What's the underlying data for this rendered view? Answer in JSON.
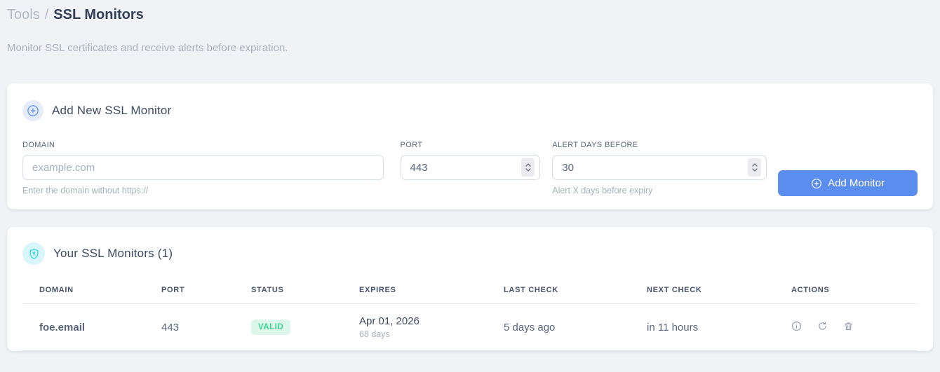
{
  "breadcrumb": {
    "section": "Tools",
    "separator": "/",
    "current": "SSL Monitors"
  },
  "subtitle": "Monitor SSL certificates and receive alerts before expiration.",
  "add_monitor_card": {
    "title": "Add New SSL Monitor",
    "icon": "circle-plus-icon",
    "fields": {
      "domain": {
        "label": "DOMAIN",
        "placeholder": "example.com",
        "value": "",
        "helper": "Enter the domain without https://"
      },
      "port": {
        "label": "PORT",
        "value": "443"
      },
      "alert_days": {
        "label": "ALERT DAYS BEFORE",
        "value": "30",
        "helper": "Alert X days before expiry"
      }
    },
    "submit_label": "Add Monitor"
  },
  "monitors_card": {
    "title": "Your SSL Monitors (1)",
    "count": 1,
    "icon": "shield-icon",
    "table": {
      "headers": [
        "DOMAIN",
        "PORT",
        "STATUS",
        "EXPIRES",
        "LAST CHECK",
        "NEXT CHECK",
        "ACTIONS"
      ],
      "rows": [
        {
          "domain": "foe.email",
          "port": "443",
          "status": "VALID",
          "expires_date": "Apr 01, 2026",
          "expires_in": "68 days",
          "last_check": "5 days ago",
          "next_check": "in 11 hours",
          "actions": [
            "info-icon",
            "refresh-icon",
            "trash-icon"
          ]
        }
      ]
    }
  },
  "colors": {
    "accent_blue": "#5b8def",
    "valid_badge_bg": "#dcf7e9",
    "valid_badge_text": "#38d695",
    "shield_cyan": "#2bd5e6",
    "page_bg": "#f0f2f5"
  }
}
